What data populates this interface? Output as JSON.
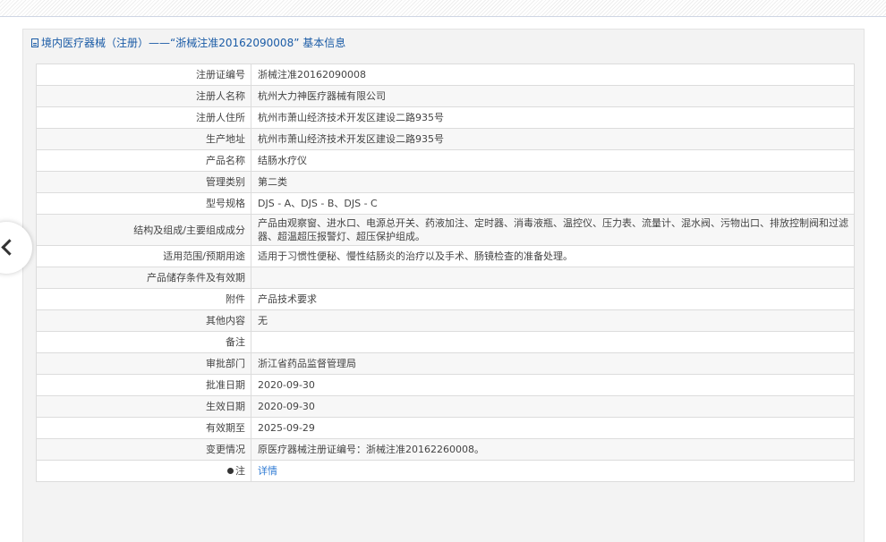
{
  "panel": {
    "title": "境内医疗器械（注册）——“浙械注准20162090008” 基本信息"
  },
  "rows": [
    {
      "label": "注册证编号",
      "value": "浙械注准20162090008"
    },
    {
      "label": "注册人名称",
      "value": "杭州大力神医疗器械有限公司"
    },
    {
      "label": "注册人住所",
      "value": "杭州市萧山经济技术开发区建设二路935号"
    },
    {
      "label": "生产地址",
      "value": "杭州市萧山经济技术开发区建设二路935号"
    },
    {
      "label": "产品名称",
      "value": "结肠水疗仪"
    },
    {
      "label": "管理类别",
      "value": "第二类"
    },
    {
      "label": "型号规格",
      "value": "DJS - A、DJS - B、DJS - C"
    },
    {
      "label": "结构及组成/主要组成成分",
      "value": "产品由观察窗、进水口、电源总开关、药液加注、定时器、消毒液瓶、温控仪、压力表、流量计、混水阀、污物出口、排放控制阀和过滤器、超温超压报警灯、超压保护组成。"
    },
    {
      "label": "适用范围/预期用途",
      "value": "适用于习惯性便秘、慢性结肠炎的治疗以及手术、肠镜检查的准备处理。"
    },
    {
      "label": "产品储存条件及有效期",
      "value": ""
    },
    {
      "label": "附件",
      "value": "产品技术要求"
    },
    {
      "label": "其他内容",
      "value": "无"
    },
    {
      "label": "备注",
      "value": ""
    },
    {
      "label": "审批部门",
      "value": "浙江省药品监督管理局"
    },
    {
      "label": "批准日期",
      "value": "2020-09-30"
    },
    {
      "label": "生效日期",
      "value": "2020-09-30"
    },
    {
      "label": "有效期至",
      "value": "2025-09-29"
    },
    {
      "label": "变更情况",
      "value": "原医疗器械注册证编号：浙械注准20162260008。"
    }
  ],
  "note_row": {
    "label": "注",
    "link": "详情"
  },
  "icons": {
    "title_icon": "document-icon",
    "note_icon": "info-dot-icon",
    "back_icon": "chevron-left-icon"
  },
  "colors": {
    "title": "#1a5ba6",
    "link": "#2f7bd4"
  }
}
